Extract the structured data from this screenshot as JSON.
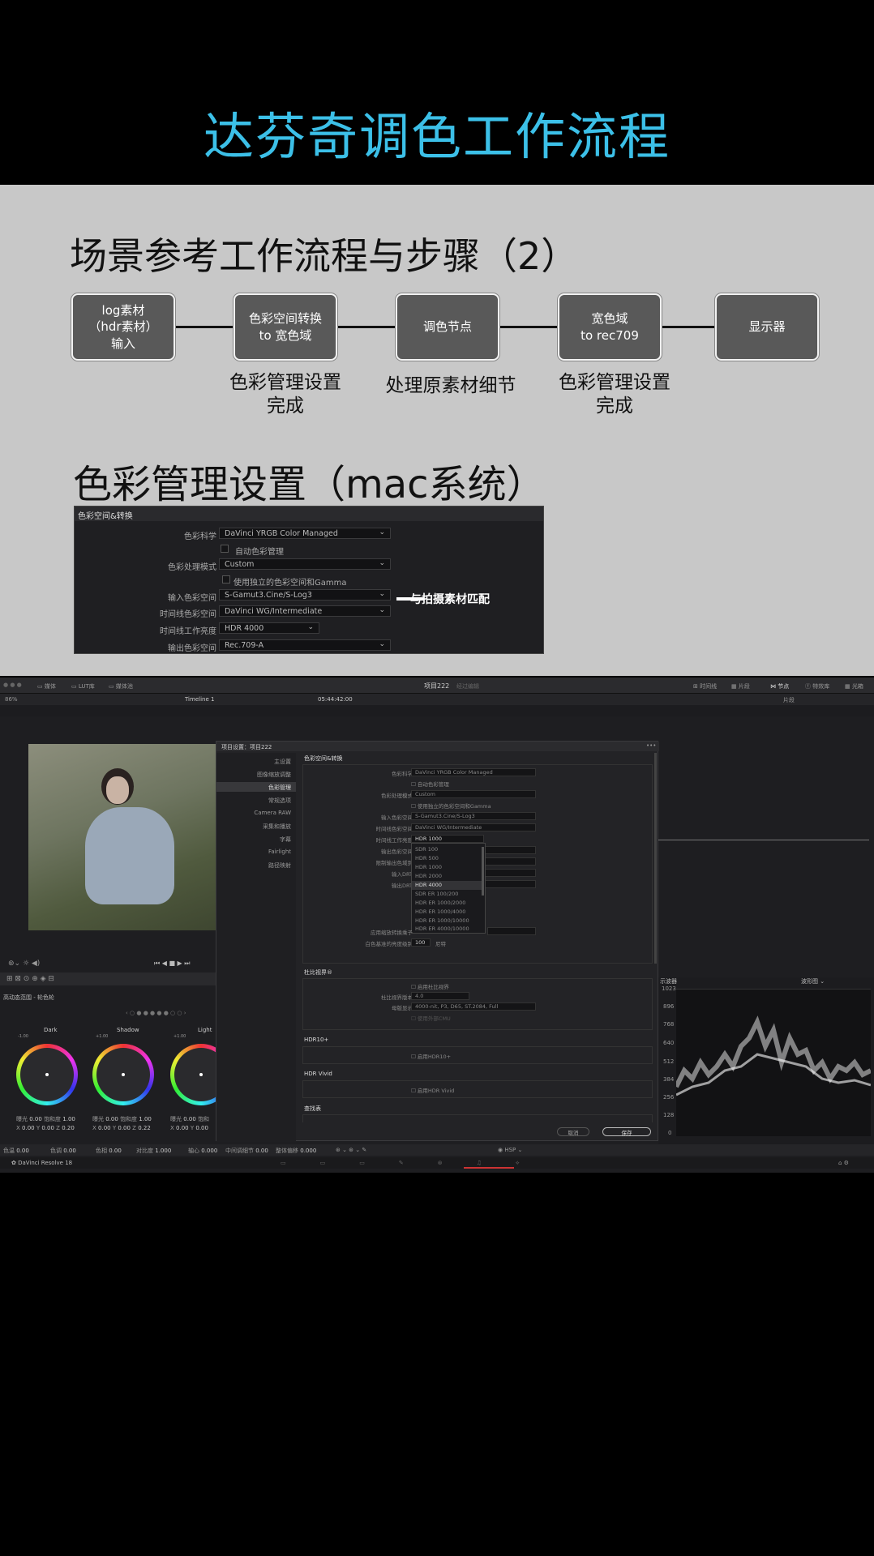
{
  "video_title": "达芬奇调色工作流程",
  "slide": {
    "heading1": "场景参考工作流程与步骤（2）",
    "flow_boxes": [
      "log素材\n（hdr素材）\n输入",
      "色彩空间转换\nto 宽色域",
      "调色节点",
      "宽色域\nto rec709",
      "显示器"
    ],
    "captions": [
      "色彩管理设置\n完成",
      "处理原素材细节",
      "色彩管理设置\n完成"
    ],
    "heading2": "色彩管理设置（mac系统）",
    "annotation": "与拍摄素材匹配"
  },
  "cm_panel": {
    "header": "色彩空间&转换",
    "rows": [
      {
        "label": "色彩科学",
        "value": "DaVinci YRGB Color Managed",
        "type": "select"
      },
      {
        "label": "",
        "value": "自动色彩管理",
        "type": "check"
      },
      {
        "label": "色彩处理模式",
        "value": "Custom",
        "type": "select"
      },
      {
        "label": "",
        "value": "使用独立的色彩空间和Gamma",
        "type": "check"
      },
      {
        "label": "输入色彩空间",
        "value": "S-Gamut3.Cine/S-Log3",
        "type": "select"
      },
      {
        "label": "时间线色彩空间",
        "value": "DaVinci WG/Intermediate",
        "type": "select"
      },
      {
        "label": "时间线工作亮度",
        "value": "HDR 4000",
        "type": "select-short"
      },
      {
        "label": "输出色彩空间",
        "value": "Rec.709-A",
        "type": "select"
      }
    ]
  },
  "resolve": {
    "top_bar": {
      "media": "媒体",
      "lut": "LUT库",
      "mediapool": "媒体池",
      "project": "项目222",
      "edited": "经过编辑",
      "timeline_view": "时间线",
      "clips": "片段",
      "nodes": "节点",
      "effects": "特效库",
      "lightbox": "光箱"
    },
    "viewer_bar": {
      "zoom": "86%",
      "timeline": "Timeline 1",
      "timecode": "05:44:42:00",
      "clip_label": "片段"
    },
    "dialog": {
      "title": "项目设置：项目222",
      "sidebar": [
        "主设置",
        "图像缩放调整",
        "色彩管理",
        "常规选项",
        "Camera RAW",
        "采集和播放",
        "字幕",
        "Fairlight",
        "路径映射"
      ],
      "section": "色彩空间&转换",
      "rows": [
        {
          "label": "色彩科学",
          "value": "DaVinci YRGB Color Managed"
        },
        {
          "label": "",
          "value": "自动色彩管理"
        },
        {
          "label": "色彩处理模式",
          "value": "Custom"
        },
        {
          "label": "",
          "value": "使用独立的色彩空间和Gamma"
        },
        {
          "label": "输入色彩空间",
          "value": "S-Gamut3.Cine/S-Log3"
        },
        {
          "label": "时间线色彩空间",
          "value": "DaVinci WG/Intermediate"
        },
        {
          "label": "时间线工作亮度",
          "value": "HDR 1000"
        },
        {
          "label": "输出色彩空间",
          "value": ""
        },
        {
          "label": "限制输出色域到",
          "value": ""
        },
        {
          "label": "输入DRT",
          "value": ""
        },
        {
          "label": "输出DRT",
          "value": ""
        }
      ],
      "dropdown": [
        "SDR 100",
        "HDR 500",
        "HDR 1000",
        "HDR 2000",
        "HDR 4000",
        "SDR ER 100/200",
        "HDR ER 1000/2000",
        "HDR ER 1000/4000",
        "HDR ER 1000/10000",
        "HDR ER 4000/10000"
      ],
      "ratio_label": "应用缩放转换乘子",
      "white_label": "白色基准的亮度级别",
      "white_value": "100",
      "white_unit": "尼特",
      "tone_section": "杜比视界®",
      "tone_enable": "启用杜比视界",
      "tone_version_label": "杜比视界版本",
      "tone_version": "4.0",
      "mastering_label": "母版显示",
      "mastering": "4000-nit, P3, D65, ST.2084, Full",
      "external": "使用外部CMU",
      "hdr10_section": "HDR10+",
      "hdr10_enable": "启用HDR10+",
      "vivid_section": "HDR Vivid",
      "vivid_enable": "启用HDR Vivid",
      "lut_section": "查找表",
      "cancel": "取消",
      "save": "保存"
    },
    "color_panel": {
      "title": "高动态范围 - 轮色轮",
      "wheels": [
        {
          "name": "Dark",
          "val": "-1.00"
        },
        {
          "name": "Shadow",
          "val": "+1.00"
        },
        {
          "name": "Light",
          "val": "+1.00"
        }
      ],
      "params": [
        {
          "lab": "曝光",
          "val": "0.00",
          "lab2": "饱和度",
          "val2": "1.00"
        },
        {
          "lab": "曝光",
          "val": "0.00",
          "lab2": "饱和度",
          "val2": "1.00"
        },
        {
          "lab": "曝光",
          "val": "0.00",
          "lab2": "饱和",
          "val2": ""
        }
      ],
      "xy": [
        {
          "x": "0.00",
          "y": "0.00",
          "z": "0.20"
        },
        {
          "x": "0.00",
          "y": "0.00",
          "z": "0.22"
        },
        {
          "x": "0.00",
          "y": "0.00",
          "z": ""
        }
      ]
    },
    "bottom_params": [
      {
        "lab": "色温",
        "val": "0.00"
      },
      {
        "lab": "色调",
        "val": "0.00"
      },
      {
        "lab": "色相",
        "val": "0.00"
      },
      {
        "lab": "对比度",
        "val": "1.000"
      },
      {
        "lab": "轴心",
        "val": "0.000"
      },
      {
        "lab": "中间调细节",
        "val": "0.00"
      },
      {
        "lab": "整体偏移",
        "val": "0.000"
      }
    ],
    "hsp": "HSP",
    "scope": {
      "title": "示波器",
      "mode": "波形图",
      "ticks": [
        "1023",
        "896",
        "768",
        "640",
        "512",
        "384",
        "256",
        "128",
        "0"
      ]
    },
    "app_name": "DaVinci Resolve 18"
  }
}
